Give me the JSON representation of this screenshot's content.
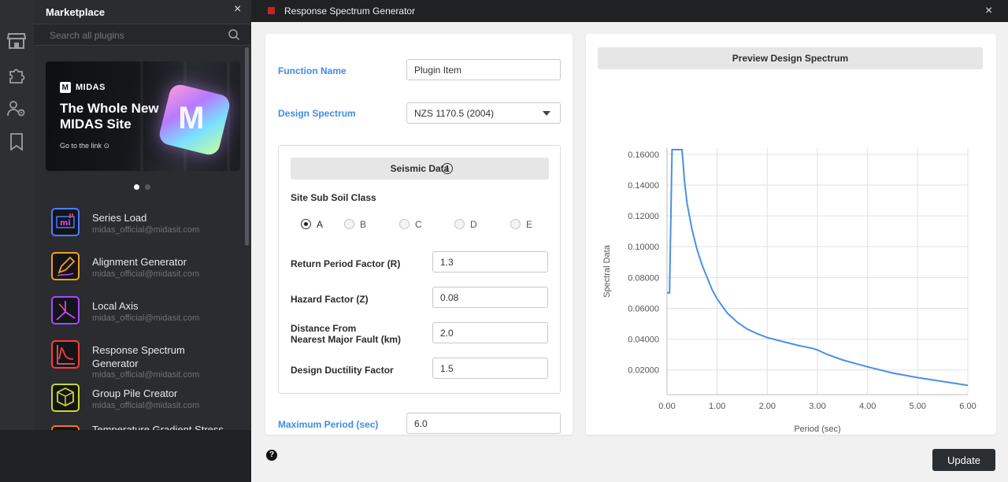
{
  "rail": {
    "icons": [
      "store-icon",
      "puzzle-icon",
      "users-settings-icon",
      "bookmark-icon"
    ]
  },
  "marketplace": {
    "title": "Marketplace",
    "close_label": "×",
    "search_placeholder": "Search all plugins",
    "banner": {
      "brand": "MIDAS",
      "brand_mark": "M",
      "headline_line1": "The Whole New",
      "headline_line2": "MIDAS Site",
      "link_text": "Go to the link ⊙"
    },
    "carousel": {
      "count": 2,
      "active_index": 0
    },
    "plugins": [
      {
        "name": "Series Load",
        "author": "midas_official@midasit.com",
        "icon": "series-load-icon",
        "color": "#4a7dff"
      },
      {
        "name": "Alignment Generator",
        "author": "midas_official@midasit.com",
        "icon": "pencil-icon",
        "color": "#f2a020"
      },
      {
        "name": "Local Axis",
        "author": "midas_official@midasit.com",
        "icon": "axis-icon",
        "color": "#a24cff"
      },
      {
        "name": "Response Spectrum Generator",
        "name_line1": "Response Spectrum",
        "name_line2": "Generator",
        "author": "midas_official@midasit.com",
        "icon": "spectrum-curve-icon",
        "color": "#ff3a3a"
      },
      {
        "name": "Group Pile Creator",
        "author": "midas_official@midasit.com",
        "icon": "pile-cube-icon",
        "color": "#c8d830"
      },
      {
        "name": "Temperature Gradient Stress",
        "author": "",
        "icon": "temperature-icon",
        "color": "#ff7020"
      }
    ]
  },
  "window": {
    "title": "Response Spectrum Generator",
    "close_label": "×"
  },
  "form": {
    "function_name": {
      "label": "Function Name",
      "value": "Plugin Item"
    },
    "design_spectrum": {
      "label": "Design Spectrum",
      "value": "NZS 1170.5 (2004)"
    },
    "seismic": {
      "header": "Seismic Data",
      "soil_class_label": "Site Sub Soil Class",
      "soil_options": [
        "A",
        "B",
        "C",
        "D",
        "E"
      ],
      "soil_selected": "A",
      "return_period": {
        "label": "Return Period Factor (R)",
        "value": "1.3"
      },
      "hazard_factor": {
        "label": "Hazard Factor (Z)",
        "value": "0.08"
      },
      "distance": {
        "label_line1": "Distance From",
        "label_line2": "Nearest Major Fault (km)",
        "value": "2.0"
      },
      "ductility": {
        "label": "Design Ductility Factor",
        "value": "1.5"
      }
    },
    "max_period": {
      "label": "Maximum Period (sec)",
      "value": "6.0"
    }
  },
  "preview": {
    "header": "Preview Design Spectrum"
  },
  "chart_data": {
    "type": "line",
    "title": "",
    "xlabel": "Period (sec)",
    "ylabel": "Spectral Data",
    "xlim": [
      0,
      6
    ],
    "ylim": [
      0.004,
      0.164
    ],
    "x_ticks": [
      "0.00",
      "1.00",
      "2.00",
      "3.00",
      "4.00",
      "5.00",
      "6.00"
    ],
    "y_ticks": [
      "0.02000",
      "0.04000",
      "0.06000",
      "0.08000",
      "0.10000",
      "0.12000",
      "0.14000",
      "0.16000"
    ],
    "grid": true,
    "line_color": "#4a90e2",
    "x": [
      0.0,
      0.05,
      0.1,
      0.3,
      0.35,
      0.4,
      0.5,
      0.6,
      0.7,
      0.8,
      0.9,
      1.0,
      1.2,
      1.4,
      1.6,
      1.8,
      2.0,
      2.3,
      2.6,
      2.9,
      3.0,
      3.2,
      3.5,
      4.0,
      4.5,
      5.0,
      5.5,
      6.0
    ],
    "y": [
      0.07,
      0.07,
      0.163,
      0.163,
      0.142,
      0.128,
      0.111,
      0.098,
      0.088,
      0.08,
      0.072,
      0.066,
      0.057,
      0.051,
      0.0465,
      0.0435,
      0.041,
      0.0385,
      0.036,
      0.034,
      0.033,
      0.03,
      0.0265,
      0.022,
      0.018,
      0.015,
      0.0125,
      0.01
    ]
  },
  "footer": {
    "help_label": "?",
    "update_label": "Update"
  }
}
